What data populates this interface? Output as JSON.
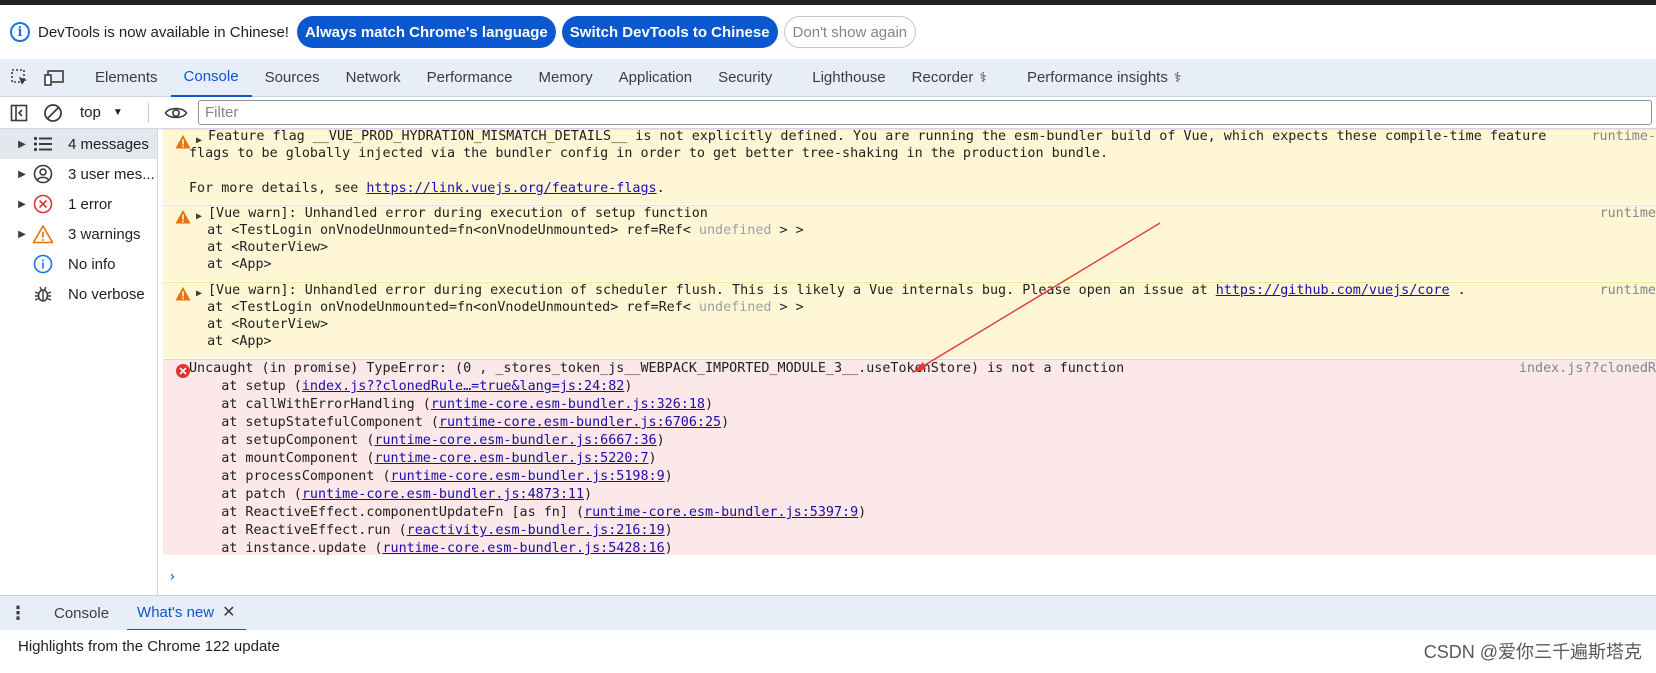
{
  "infobar": {
    "message": "DevTools is now available in Chinese!",
    "btn_match": "Always match Chrome's language",
    "btn_switch": "Switch DevTools to Chinese",
    "btn_dismiss": "Don't show again"
  },
  "tabs": [
    "Elements",
    "Console",
    "Sources",
    "Network",
    "Performance",
    "Memory",
    "Application",
    "Security",
    "Lighthouse",
    "Recorder",
    "Performance insights"
  ],
  "active_tab": "Console",
  "toolbar": {
    "context": "top",
    "filter_placeholder": "Filter"
  },
  "sidebar": {
    "items": [
      {
        "label": "4 messages",
        "icon": "list-icon"
      },
      {
        "label": "3 user mes...",
        "icon": "user-icon"
      },
      {
        "label": "1 error",
        "icon": "error-icon"
      },
      {
        "label": "3 warnings",
        "icon": "warning-icon"
      },
      {
        "label": "No info",
        "icon": "info-icon"
      },
      {
        "label": "No verbose",
        "icon": "bug-icon"
      }
    ]
  },
  "messages": {
    "m1": {
      "l1": "Feature flag __VUE_PROD_HYDRATION_MISMATCH_DETAILS__ is not explicitly defined. You are running the esm-bundler build of Vue, which expects these compile-time feature",
      "l2": "flags to be globally injected via the bundler config in order to get better tree-shaking in the production bundle.",
      "l3_prefix": "For more details, see ",
      "l3_link": "https://link.vuejs.org/feature-flags",
      "l3_suffix": ".",
      "source": "runtime-"
    },
    "m2": {
      "l1": "[Vue warn]: Unhandled error during execution of setup function",
      "l2_prefix": "  at <TestLogin onVnodeUnmounted=fn<onVnodeUnmounted> ref=Ref< ",
      "l2_undef": "undefined",
      "l2_suffix": " > >",
      "l3": "  at <RouterView>",
      "l4": "  at <App>",
      "source": "runtime"
    },
    "m3": {
      "l1_prefix": "[Vue warn]: Unhandled error during execution of scheduler flush. This is likely a Vue internals bug. Please open an issue at ",
      "l1_link": "https://github.com/vuejs/core",
      "l1_suffix": " .",
      "l2_prefix": "  at <TestLogin onVnodeUnmounted=fn<onVnodeUnmounted> ref=Ref< ",
      "l2_undef": "undefined",
      "l2_suffix": " > >",
      "l3": "  at <RouterView>",
      "l4": "  at <App>",
      "source": "runtime"
    },
    "m4": {
      "title": "Uncaught (in promise) TypeError: (0 , _stores_token_js__WEBPACK_IMPORTED_MODULE_3__.useTokenStore) is not a function",
      "source": "index.js??clonedR",
      "stack": [
        {
          "pre": "    at setup (",
          "link": "index.js??clonedRule…=true&lang=js:24:82",
          "post": ")"
        },
        {
          "pre": "    at callWithErrorHandling (",
          "link": "runtime-core.esm-bundler.js:326:18",
          "post": ")"
        },
        {
          "pre": "    at setupStatefulComponent (",
          "link": "runtime-core.esm-bundler.js:6706:25",
          "post": ")"
        },
        {
          "pre": "    at setupComponent (",
          "link": "runtime-core.esm-bundler.js:6667:36",
          "post": ")"
        },
        {
          "pre": "    at mountComponent (",
          "link": "runtime-core.esm-bundler.js:5220:7",
          "post": ")"
        },
        {
          "pre": "    at processComponent (",
          "link": "runtime-core.esm-bundler.js:5198:9",
          "post": ")"
        },
        {
          "pre": "    at patch (",
          "link": "runtime-core.esm-bundler.js:4873:11",
          "post": ")"
        },
        {
          "pre": "    at ReactiveEffect.componentUpdateFn [as fn] (",
          "link": "runtime-core.esm-bundler.js:5397:9",
          "post": ")"
        },
        {
          "pre": "    at ReactiveEffect.run (",
          "link": "reactivity.esm-bundler.js:216:19",
          "post": ")"
        },
        {
          "pre": "    at instance.update (",
          "link": "runtime-core.esm-bundler.js:5428:16",
          "post": ")"
        }
      ]
    }
  },
  "prompt": "›",
  "drawer": {
    "tab_console": "Console",
    "tab_whats_new": "What's new",
    "highlights": "Highlights from the Chrome 122 update"
  },
  "watermark": "CSDN @爱你三千遍斯塔克",
  "colors": {
    "accent": "#0b57d0",
    "warning_bg": "#fef6d5",
    "error_bg": "#fce8e8",
    "arrow": "#e53935"
  }
}
